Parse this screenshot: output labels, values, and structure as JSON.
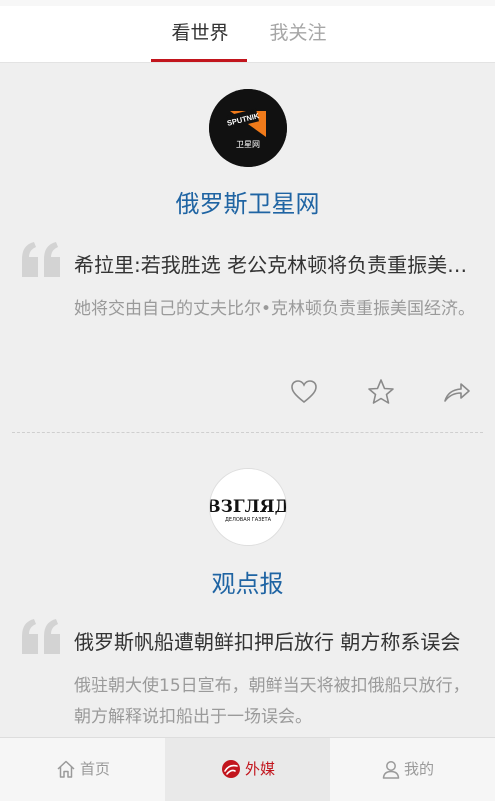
{
  "tabs": {
    "world": "看世界",
    "following": "我关注"
  },
  "colors": {
    "accent": "#c2151d",
    "source_blue": "#1f64a3"
  },
  "feed": [
    {
      "logo": {
        "icon": "sputnik-logo",
        "word": "SPUTNIK",
        "caption": "卫星网"
      },
      "source": "俄罗斯卫星网",
      "headline": "希拉里:若我胜选 老公克林顿将负责重振美国经济",
      "summary": "她将交由自己的丈夫比尔•克林顿负责重振美国经济。"
    },
    {
      "logo": {
        "icon": "vzglyad-logo",
        "word": "ВЗГЛЯД",
        "caption": "ДЕЛОВАЯ ГАЗЕТА"
      },
      "source": "观点报",
      "headline": "俄罗斯帆船遭朝鲜扣押后放行 朝方称系误会",
      "summary": "俄驻朝大使15日宣布，朝鲜当天将被扣俄船只放行，朝方解释说扣船出于一场误会。"
    }
  ],
  "actions": {
    "like": "heart-icon",
    "favorite": "star-icon",
    "share": "share-icon"
  },
  "bottom_nav": [
    {
      "label": "首页",
      "icon": "home-icon"
    },
    {
      "label": "外媒",
      "icon": "foreign-media-icon",
      "active": true
    },
    {
      "label": "我的",
      "icon": "user-icon"
    }
  ]
}
